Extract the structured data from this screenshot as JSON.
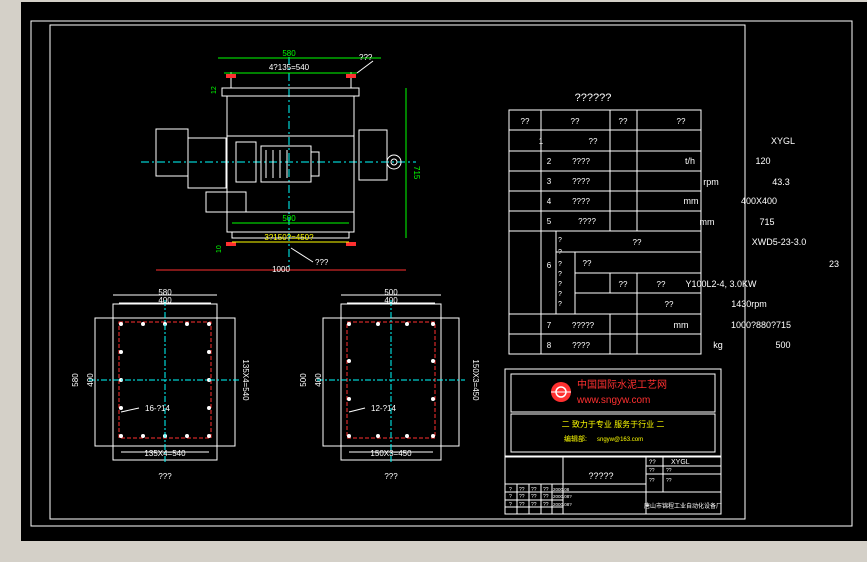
{
  "dims": {
    "top_580": "580",
    "top_bolt": "4?135=540",
    "top_note": "???",
    "top_12": "12",
    "right_715": "715",
    "bot_500": "500",
    "bot_bolt": "3?150?=450?",
    "bot_10": "10",
    "bot_1000": "1000",
    "bot_note": "???"
  },
  "flange_left": {
    "w_outer": "580",
    "w_inner": "400",
    "h_outer": "580",
    "h_inner": "400",
    "side": "135X4=540",
    "hole": "16-?14",
    "bottom": "135X4=540",
    "caption": "???"
  },
  "flange_right": {
    "w_outer": "500",
    "w_inner": "400",
    "h_outer": "500",
    "h_inner": "400",
    "side": "150X3=450",
    "hole": "12-?14",
    "bottom": "150X3=450",
    "caption": "???"
  },
  "table": {
    "title": "??????",
    "headers": [
      "??",
      "??",
      "??",
      "??"
    ],
    "rows": [
      {
        "no": "1",
        "name": "??",
        "unit": "",
        "value": "XYGL"
      },
      {
        "no": "2",
        "name": "????",
        "unit": "t/h",
        "value": "120"
      },
      {
        "no": "3",
        "name": "????",
        "unit": "rpm",
        "value": "43.3"
      },
      {
        "no": "4",
        "name": "????",
        "unit": "mm",
        "value": "400X400"
      },
      {
        "no": "5",
        "name": "????",
        "unit": "mm",
        "value": "715"
      },
      {
        "no": "7",
        "name": "?????",
        "unit": "mm",
        "value": "1000?880?715"
      },
      {
        "no": "8",
        "name": "????",
        "unit": "kg",
        "value": "500"
      }
    ],
    "row6": {
      "no": "6",
      "vert": [
        "?",
        "?",
        "?",
        "?",
        "?",
        "?",
        "?"
      ],
      "r1": "??",
      "r1v": "XWD5-23-3.0",
      "r1v2": "23",
      "r2": "??",
      "r3a": "??",
      "r3b": "??",
      "r3v": "Y100L2-4, 3.0KW",
      "r4": "??",
      "r4v": "1430rpm"
    }
  },
  "logo": {
    "name": "中国国际水泥工艺网",
    "url": "www.sngyw.com",
    "slogan": "二 致力于专业  服务于行业 二",
    "contact_label": "编辑部:",
    "contact": "sngyw@163.com"
  },
  "title_block": {
    "drawing_name": "?????",
    "code_label": "??",
    "code": "XYGL",
    "rev1": [
      "?",
      "?",
      "??",
      "??",
      "??",
      "2000.08"
    ],
    "rev2": [
      "?",
      "?",
      "??",
      "??",
      "??",
      "2000.08?"
    ],
    "rev3": [
      "?",
      "?",
      "??",
      "??",
      "??",
      "2000.08?"
    ],
    "company": "唐山市锦程工业自动化设备厂",
    "sheet_fields": [
      "??",
      "??",
      "??",
      "??"
    ]
  },
  "colors": {
    "background": "#000000",
    "frame": "#ffffff",
    "dimension": "#00ff00",
    "centerline": "#00ffff",
    "annotation": "#ffff00",
    "flange_hidden": "#ff3030"
  }
}
